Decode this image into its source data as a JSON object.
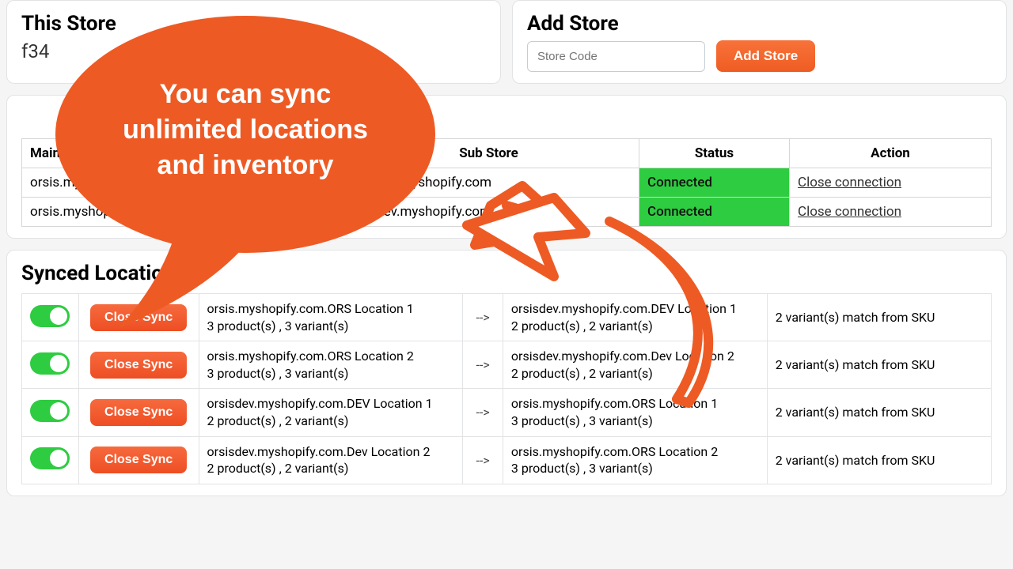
{
  "thisStore": {
    "title": "This Store",
    "code": "f34"
  },
  "addStore": {
    "title": "Add Store",
    "placeholder": "Store Code",
    "button": "Add Store"
  },
  "connections": {
    "headers": [
      "Main Store",
      "Sub Store",
      "Status",
      "Action"
    ],
    "rows": [
      {
        "main": "orsis.myshopify.com",
        "sub": "orsisdev.myshopify.com",
        "status": "Connected",
        "action": "Close connection"
      },
      {
        "main": "orsis.myshopify.com",
        "sub": "orsisdev.myshopify.com",
        "status": "Connected",
        "action": "Close connection"
      }
    ]
  },
  "synced": {
    "title": "Synced Location(s)",
    "closeSync": "Close Sync",
    "arrow": "-->",
    "rows": [
      {
        "srcLine1": "orsis.myshopify.com.ORS Location 1",
        "srcLine2": "3 product(s) , 3 variant(s)",
        "dstLine1": "orsisdev.myshopify.com.DEV Location 1",
        "dstLine2": "2 product(s) , 2 variant(s)",
        "match": "2 variant(s) match from SKU"
      },
      {
        "srcLine1": "orsis.myshopify.com.ORS Location 2",
        "srcLine2": "3 product(s) , 3 variant(s)",
        "dstLine1": "orsisdev.myshopify.com.Dev Location 2",
        "dstLine2": "2 product(s) , 2 variant(s)",
        "match": "2 variant(s) match from SKU"
      },
      {
        "srcLine1": "orsisdev.myshopify.com.DEV Location 1",
        "srcLine2": "2 product(s) , 2 variant(s)",
        "dstLine1": "orsis.myshopify.com.ORS Location 1",
        "dstLine2": "3 product(s) , 3 variant(s)",
        "match": "2 variant(s) match from SKU"
      },
      {
        "srcLine1": "orsisdev.myshopify.com.Dev Location 2",
        "srcLine2": "2 product(s) , 2 variant(s)",
        "dstLine1": "orsis.myshopify.com.ORS Location 2",
        "dstLine2": "3 product(s) , 3 variant(s)",
        "match": "2 variant(s) match from SKU"
      }
    ]
  },
  "callout": {
    "line1": "You can sync",
    "line2": "unlimited locations",
    "line3": "and inventory"
  },
  "colors": {
    "orange": "#ee5a24",
    "green": "#2ecc40"
  }
}
